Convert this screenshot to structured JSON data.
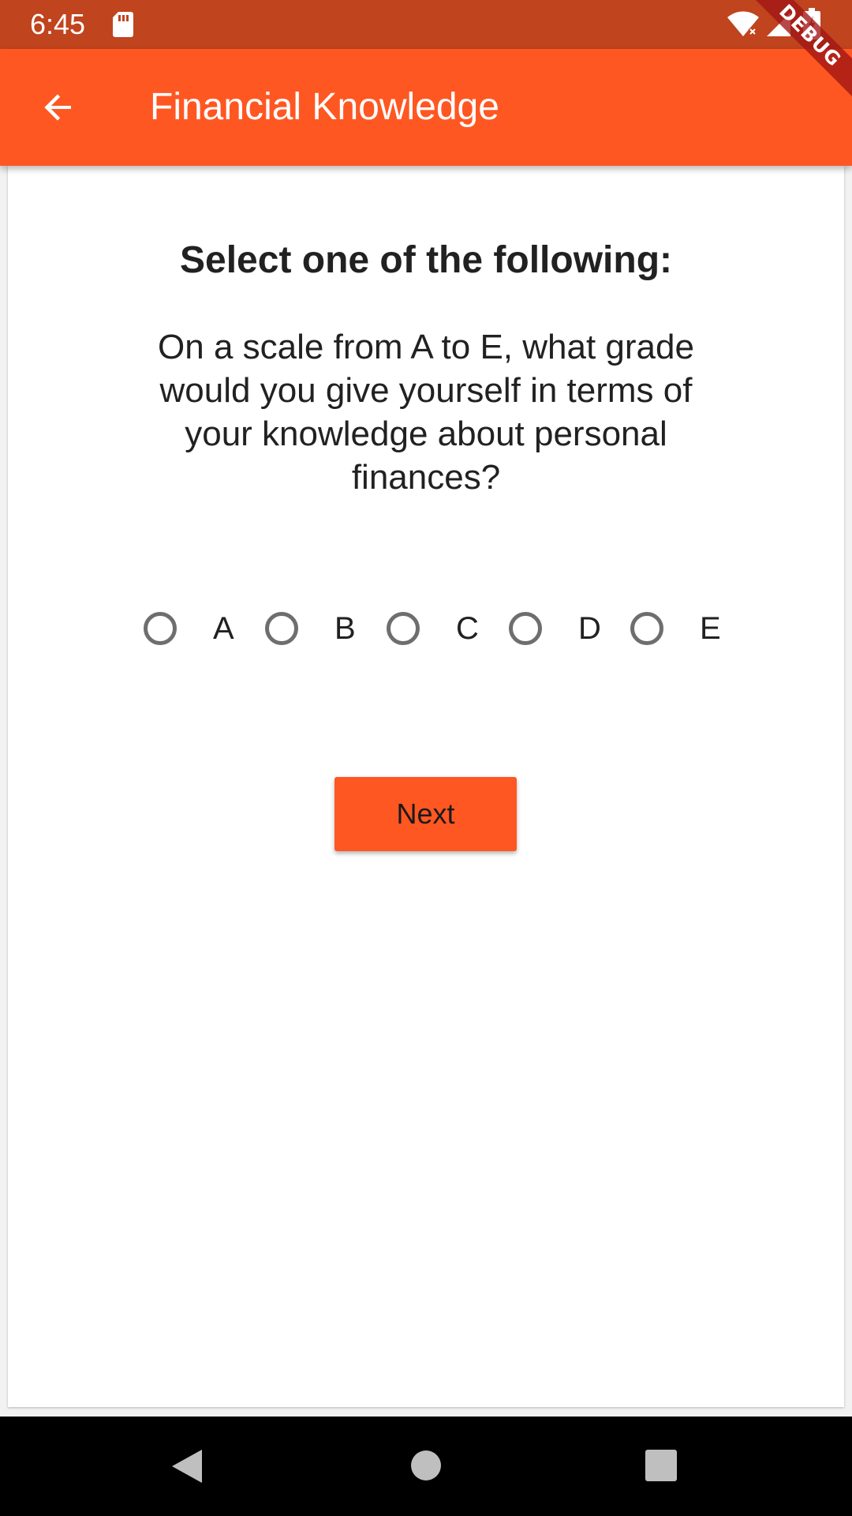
{
  "status_bar": {
    "time": "6:45",
    "icons": [
      "sd-card-icon",
      "wifi-icon",
      "signal-icon",
      "battery-icon"
    ]
  },
  "app_bar": {
    "title": "Financial Knowledge",
    "back_icon": "arrow-left-icon"
  },
  "debug_banner": "DEBUG",
  "question": {
    "heading": "Select one of the following:",
    "text": "On a scale from A to E, what grade would you give yourself in terms of your knowledge about personal finances?",
    "options": [
      {
        "label": "A",
        "selected": false
      },
      {
        "label": "B",
        "selected": false
      },
      {
        "label": "C",
        "selected": false
      },
      {
        "label": "D",
        "selected": false
      },
      {
        "label": "E",
        "selected": false
      }
    ]
  },
  "next_button": {
    "label": "Next"
  },
  "colors": {
    "status_bar": "#c0441e",
    "app_bar": "#ff5722",
    "button": "#ff5722",
    "radio_border": "#6e6e6e"
  },
  "nav_bar": {
    "buttons": [
      "nav-back-icon",
      "nav-home-icon",
      "nav-recents-icon"
    ]
  }
}
